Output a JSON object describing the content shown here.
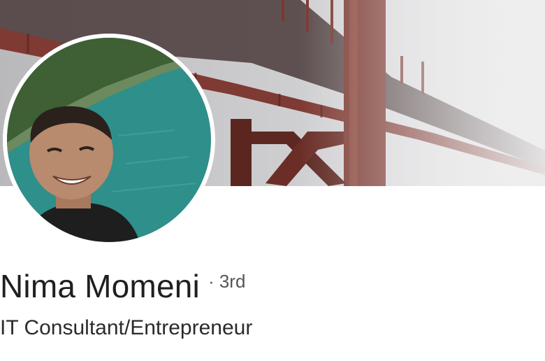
{
  "profile": {
    "name": "Nima Momeni",
    "degree": "· 3rd",
    "headline": "IT Consultant/Entrepreneur"
  },
  "cover": {
    "icon": "golden-gate-bridge-in-fog",
    "colors": {
      "fog": "#d4d4d6",
      "bridge": "#7e3a33",
      "bridge_dark": "#5b2620"
    }
  },
  "avatar": {
    "icon": "selfie-by-water",
    "colors": {
      "water": "#2f8f8a",
      "shore": "#3f5f35",
      "skin": "#b88a6e",
      "border": "#ffffff"
    }
  }
}
